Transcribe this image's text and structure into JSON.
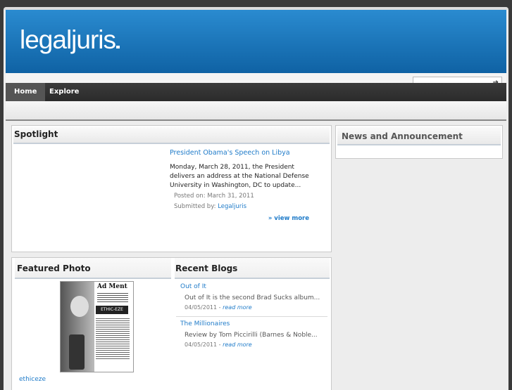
{
  "site": {
    "logo": "legaljuris"
  },
  "nav": {
    "tabs": [
      {
        "label": "Home"
      },
      {
        "label": "Explore"
      }
    ]
  },
  "search": {
    "placeholder": "Search"
  },
  "spotlight": {
    "title": "Spotlight",
    "headline": "President Obama's Speech on Libya",
    "summary": "Monday, March 28, 2011, the President delivers an address at the National Defense University in Washington, DC to update...",
    "posted_label": "Posted on:",
    "posted_date": "March 31, 2011",
    "submitted_label": "Submitted by:",
    "submitted_by": "Legaljuris",
    "view_more": "» view more"
  },
  "news": {
    "title": "News and Announcement"
  },
  "featured_photo": {
    "title": "Featured Photo",
    "caption": "ethiceze",
    "ad_heading": "Ad Ment",
    "ad_brand": "ETHIC-EZE"
  },
  "recent_blogs": {
    "title": "Recent Blogs",
    "posts": [
      {
        "title": "Out of It",
        "excerpt": "Out of It is the second Brad Sucks album...",
        "date": "04/05/2011",
        "read_more": "read more"
      },
      {
        "title": "The Millionaires",
        "excerpt": "Review by Tom Piccirilli (Barnes & Noble...",
        "date": "04/05/2011",
        "read_more": "read more"
      }
    ]
  }
}
